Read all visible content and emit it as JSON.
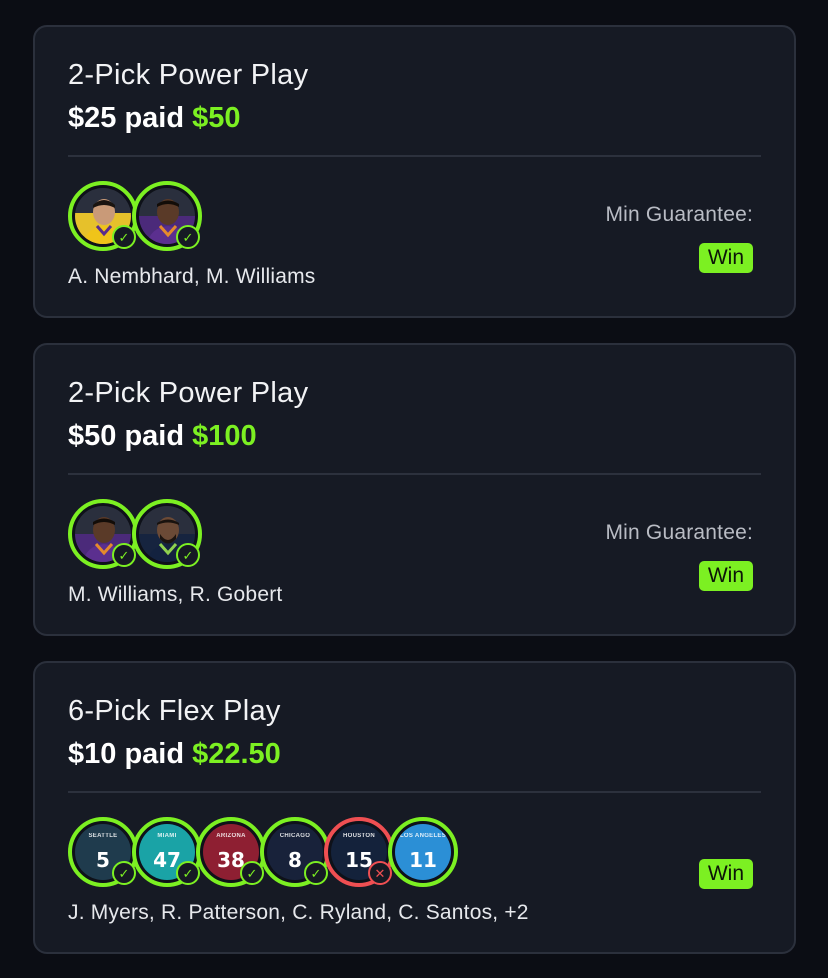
{
  "colors": {
    "accent_green": "#7cf022",
    "loss_red": "#ef4f52",
    "card_bg": "#161a24",
    "page_bg": "#0b0d14"
  },
  "cards": [
    {
      "title": "2-Pick Power Play",
      "paid": "$25 paid",
      "payout": "$50",
      "min_guarantee_label": "Min Guarantee:",
      "result": "Win",
      "players_text": "A. Nembhard, M. Williams",
      "picks": [
        {
          "type": "headshot",
          "status": "hit",
          "icon": "check-icon"
        },
        {
          "type": "headshot",
          "status": "hit",
          "icon": "check-icon"
        }
      ]
    },
    {
      "title": "2-Pick Power Play",
      "paid": "$50 paid",
      "payout": "$100",
      "min_guarantee_label": "Min Guarantee:",
      "result": "Win",
      "players_text": "M. Williams, R. Gobert",
      "picks": [
        {
          "type": "headshot",
          "status": "hit",
          "icon": "check-icon"
        },
        {
          "type": "headshot",
          "status": "hit",
          "icon": "check-icon"
        }
      ]
    },
    {
      "title": "6-Pick Flex Play",
      "paid": "$10 paid",
      "payout": "$22.50",
      "result": "Win",
      "players_text": "J. Myers, R. Patterson, C. Ryland, C. Santos, +2",
      "picks": [
        {
          "type": "jersey",
          "team": "SEATTLE",
          "number": "5",
          "status": "hit",
          "icon": "check-icon"
        },
        {
          "type": "jersey",
          "team": "MIAMI",
          "number": "47",
          "status": "hit",
          "icon": "check-icon"
        },
        {
          "type": "jersey",
          "team": "ARIZONA",
          "number": "38",
          "status": "hit",
          "icon": "check-icon"
        },
        {
          "type": "jersey",
          "team": "CHICAGO",
          "number": "8",
          "status": "hit",
          "icon": "check-icon"
        },
        {
          "type": "jersey",
          "team": "HOUSTON",
          "number": "15",
          "status": "miss",
          "icon": "x-icon"
        },
        {
          "type": "jersey",
          "team": "LOS ANGELES",
          "number": "11",
          "status": "none",
          "icon": ""
        }
      ]
    }
  ]
}
